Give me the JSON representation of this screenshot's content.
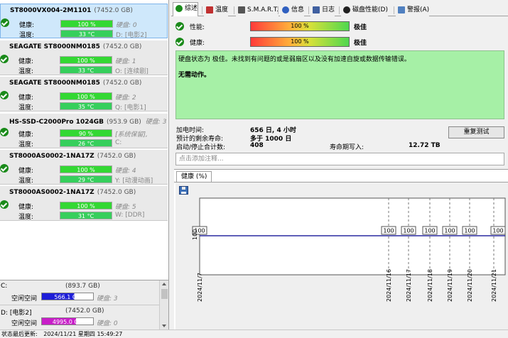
{
  "left": {
    "disks": [
      {
        "name": "ST8000VX004-2M1101",
        "capacity": "(7452.0 GB)",
        "health_label": "健康:",
        "health": "100 %",
        "hdd_label": "硬盘:",
        "hdd_index": "0",
        "temp_label": "温度:",
        "temp": "33 °C",
        "drive": "D: [电影2]",
        "selected": true
      },
      {
        "name": "SEAGATE ST8000NM0185",
        "capacity": "(7452.0 GB)",
        "health_label": "健康:",
        "health": "100 %",
        "hdd_label": "硬盘:",
        "hdd_index": "1",
        "temp_label": "温度:",
        "temp": "33 °C",
        "drive": "O: [连续剧]",
        "selected": false
      },
      {
        "name": "SEAGATE ST8000NM0185",
        "capacity": "(7452.0 GB)",
        "health_label": "健康:",
        "health": "100 %",
        "hdd_label": "硬盘:",
        "hdd_index": "2",
        "temp_label": "温度:",
        "temp": "35 °C",
        "drive": "Q: [电影1]",
        "selected": false
      },
      {
        "name": "HS-SSD-C2000Pro 1024GB",
        "capacity": "(953.9 GB)",
        "health_label": "健康:",
        "health": "90 %",
        "hdd_label": "硬盘:",
        "hdd_index": "3",
        "temp_label": "温度:",
        "temp": "26 °C",
        "drive": "[系统保留],",
        "drive2": "C:",
        "selected": false
      },
      {
        "name": "ST8000AS0002-1NA17Z",
        "capacity": "(7452.0 GB)",
        "health_label": "健康:",
        "health": "100 %",
        "hdd_label": "硬盘:",
        "hdd_index": "4",
        "temp_label": "温度:",
        "temp": "29 °C",
        "drive": "Y: [动漫动画]",
        "selected": false
      },
      {
        "name": "ST8000AS0002-1NA17Z",
        "capacity": "(7452.0 GB)",
        "health_label": "健康:",
        "health": "100 %",
        "hdd_label": "硬盘:",
        "hdd_index": "5",
        "temp_label": "温度:",
        "temp": "31 °C",
        "drive": "W: [DDR]",
        "selected": false
      }
    ],
    "volumes": [
      {
        "name": "C:",
        "capacity": "(893.7 GB)",
        "free_label": "空闲空间",
        "free": "566.1 GB",
        "free_fraction": 0.63,
        "color": "#1e1ed8",
        "hdd_label": "硬盘:",
        "hdd_index": "3"
      },
      {
        "name": "D: [电影2]",
        "capacity": "(7452.0 GB)",
        "free_label": "空闲空间",
        "free": "4995.0 GB",
        "free_fraction": 0.67,
        "color": "#c81ec8",
        "hdd_label": "硬盘:",
        "hdd_index": "0"
      }
    ]
  },
  "status": {
    "label": "状态最后更新:",
    "value": "2024/11/21 星期四 15:49:27"
  },
  "tabs": [
    {
      "label": "综述",
      "icon": "check-circle-icon",
      "color": "#1a8a1a"
    },
    {
      "label": "温度",
      "icon": "thermometer-icon",
      "color": "#c03030"
    },
    {
      "label": "S.M.A.R.T.",
      "icon": "smart-icon",
      "color": "#555555"
    },
    {
      "label": "信息",
      "icon": "info-icon",
      "color": "#3060c0"
    },
    {
      "label": "日志",
      "icon": "log-icon",
      "color": "#4060a0"
    },
    {
      "label": "磁盘性能(D)",
      "icon": "performance-icon",
      "color": "#202020"
    },
    {
      "label": "警报(A)",
      "icon": "alert-icon",
      "color": "#5080c0"
    }
  ],
  "summary": {
    "performance_label": "性能:",
    "performance": "100 %",
    "performance_verdict": "极佳",
    "health_label": "健康:",
    "health": "100 %",
    "health_verdict": "极佳",
    "message": "硬盘状态为 极佳。未找到有问题的或是弱扇区以及没有加速自旋或数据传输错误。",
    "action": "无需动作。",
    "power_on_label": "加电时间:",
    "power_on": "656 日, 4 小时",
    "remaining_label": "预计的剩余寿命:",
    "remaining": "多于 1000 日",
    "start_stop_label": "启动/停止合计数:",
    "start_stop": "408",
    "lifetime_writes_label": "寿命期写入:",
    "lifetime_writes": "12.72 TB",
    "retest_label": "重复测试",
    "note_placeholder": "点击添加注释..."
  },
  "chart_data": {
    "type": "line",
    "tab_label": "健康 (%)",
    "ylabel": "100",
    "ylim": [
      0,
      100
    ],
    "x": [
      "2024/11/7",
      "2024/11/16",
      "2024/11/17",
      "2024/11/18",
      "2024/11/19",
      "2024/11/20",
      "2024/11/21"
    ],
    "values": [
      100,
      100,
      100,
      100,
      100,
      100,
      100
    ],
    "point_labels": [
      "100",
      "100",
      "100",
      "100",
      "100",
      "100",
      "100"
    ],
    "line_color": "#2a2aa0"
  }
}
